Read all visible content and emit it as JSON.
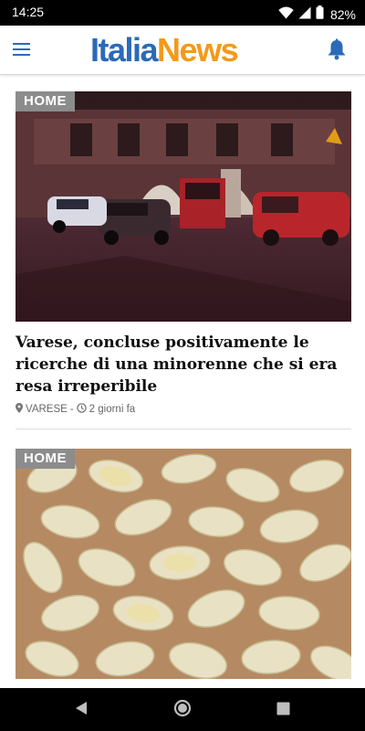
{
  "status_bar": {
    "time": "14:25",
    "battery": "82%",
    "icons": [
      "wifi-icon",
      "signal-icon",
      "battery-icon"
    ]
  },
  "header": {
    "logo_part_1": "Italia",
    "logo_part_2": "News",
    "menu_icon": "menu-icon",
    "notification_icon": "bell-icon",
    "colors": {
      "logo_blue": "#2a6ab8",
      "logo_orange": "#f39a1a"
    }
  },
  "articles": [
    {
      "category": "HOME",
      "title": "Varese, concluse positivamente le ricerche di una minorenne che si era resa irreperibile",
      "location": "VARESE",
      "separator": "-",
      "time_ago": "2 giorni fa",
      "image": "night street scene with police and fire vehicles"
    },
    {
      "category": "HOME",
      "image": "pile of white capsules"
    }
  ],
  "nav_bar": {
    "icons": [
      "back-icon",
      "home-icon",
      "recents-icon"
    ]
  }
}
